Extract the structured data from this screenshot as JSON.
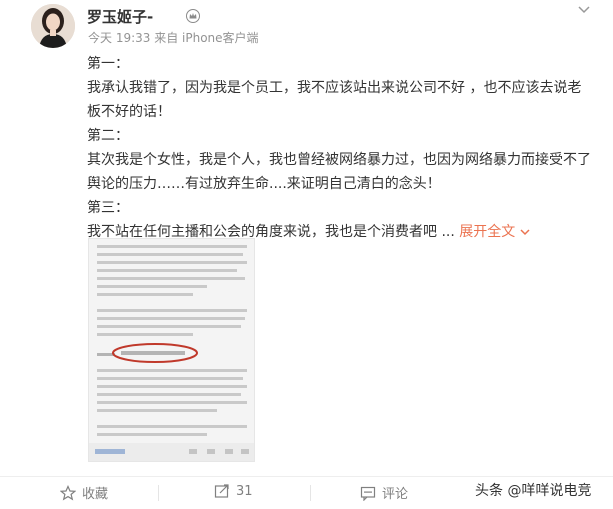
{
  "post": {
    "username": "罗玉姬子-",
    "meta": "今天 19:33 来自 iPhone客户端",
    "paragraphs": {
      "p1_title": "第一：",
      "p1_body": "我承认我错了，因为我是个员工，我不应该站出来说公司不好 ，也不应该去说老板不好的话！",
      "p2_title": "第二：",
      "p2_body": "其次我是个女性，我是个人，我也曾经被网络暴力过，也因为网络暴力而接受不了舆论的压力……有过放弃生命....来证明自己清白的念头！",
      "p3_title": "第三：",
      "p3_body": "我不站在任何主播和公会的角度来说，我也是个消费者吧 ...",
      "expand_label": "展开全文"
    }
  },
  "actions": {
    "favorite_label": "收藏",
    "repost_count": "31",
    "comment_label": "评论"
  },
  "watermark": "头条 @咩咩说电竞",
  "icons": [
    "crown-icon",
    "chevron-down-icon",
    "star-icon",
    "share-icon",
    "comment-icon"
  ],
  "colors": {
    "accent": "#eb7350",
    "meta": "#939393",
    "text": "#333333"
  }
}
